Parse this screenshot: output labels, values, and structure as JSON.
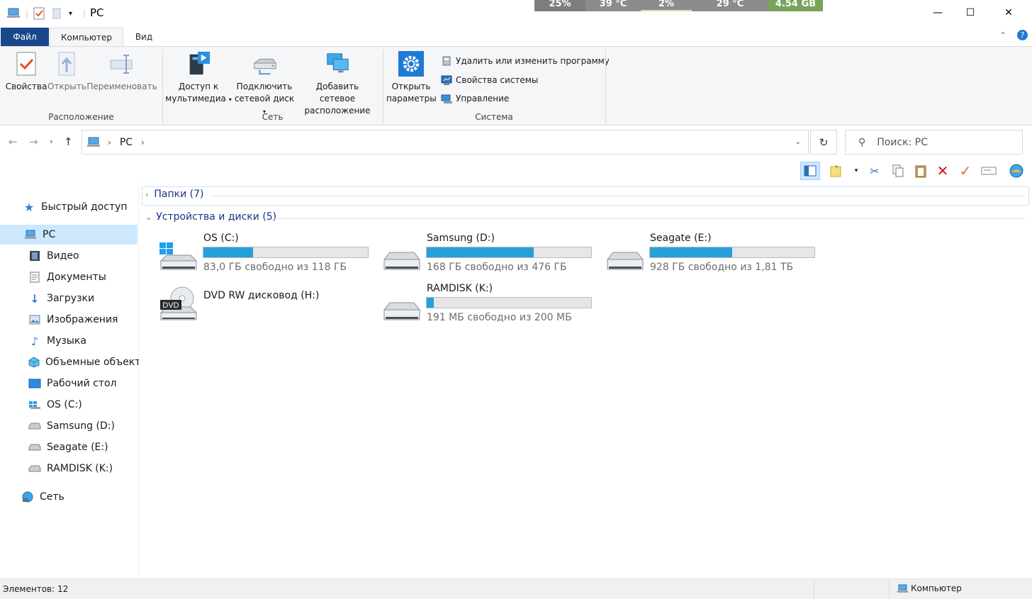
{
  "window": {
    "title": "PC",
    "controls": {
      "minimize": "—",
      "maximize": "☐",
      "close": "✕"
    }
  },
  "overlay": {
    "cpu": "25%",
    "cpu_temp": "39 °C",
    "gpu": "2%",
    "gpu_temp": "29 °C",
    "ram": "4.54 GB"
  },
  "ribbon": {
    "tabs": [
      {
        "label": "Файл"
      },
      {
        "label": "Компьютер"
      },
      {
        "label": "Вид"
      }
    ],
    "location": {
      "label": "Расположение",
      "properties": "Свойства",
      "open": "Открыть",
      "rename": "Переименовать"
    },
    "network": {
      "label": "Сеть",
      "media_line1": "Доступ к",
      "media_line2": "мультимедиа",
      "map_line1": "Подключить",
      "map_line2": "сетевой диск",
      "add_line1": "Добавить сетевое",
      "add_line2": "расположение"
    },
    "system": {
      "label": "Система",
      "settings_line1": "Открыть",
      "settings_line2": "параметры",
      "uninstall": "Удалить или изменить программу",
      "sysprops": "Свойства системы",
      "manage": "Управление"
    }
  },
  "address": {
    "crumb": "PC",
    "search_placeholder": "Поиск: PC"
  },
  "sidebar": {
    "quick_access": "Быстрый доступ",
    "pc": "PC",
    "items": [
      {
        "label": "Видео",
        "icon": "video-folder-icon"
      },
      {
        "label": "Документы",
        "icon": "documents-folder-icon"
      },
      {
        "label": "Загрузки",
        "icon": "downloads-folder-icon"
      },
      {
        "label": "Изображения",
        "icon": "pictures-folder-icon"
      },
      {
        "label": "Музыка",
        "icon": "music-folder-icon"
      },
      {
        "label": "Объемные объекты",
        "icon": "3d-objects-folder-icon"
      },
      {
        "label": "Рабочий стол",
        "icon": "desktop-folder-icon"
      },
      {
        "label": "OS (C:)",
        "icon": "windows-drive-icon"
      },
      {
        "label": "Samsung (D:)",
        "icon": "drive-icon"
      },
      {
        "label": "Seagate (E:)",
        "icon": "drive-icon"
      },
      {
        "label": "RAMDISK (K:)",
        "icon": "drive-icon"
      }
    ],
    "network": "Сеть"
  },
  "main": {
    "folders_group": "Папки (7)",
    "devices_group": "Устройства и диски (5)",
    "drives": [
      {
        "name": "OS (C:)",
        "free": "83,0 ГБ свободно из 118 ГБ",
        "used_fraction": 0.3
      },
      {
        "name": "Samsung (D:)",
        "free": "168 ГБ свободно из 476 ГБ",
        "used_fraction": 0.65
      },
      {
        "name": "Seagate (E:)",
        "free": "928 ГБ свободно из 1,81 ТБ",
        "used_fraction": 0.5
      },
      {
        "name": "DVD RW дисковод (H:)"
      },
      {
        "name": "RAMDISK (K:)",
        "free": "191 МБ свободно из 200 МБ",
        "used_fraction": 0.045
      }
    ]
  },
  "status": {
    "items_count": "Элементов: 12",
    "location": "Компьютер"
  },
  "colors": {
    "accent": "#19478a",
    "bar_fill": "#26a0da",
    "group_header": "#1e3287",
    "selected": "#cce8ff"
  }
}
